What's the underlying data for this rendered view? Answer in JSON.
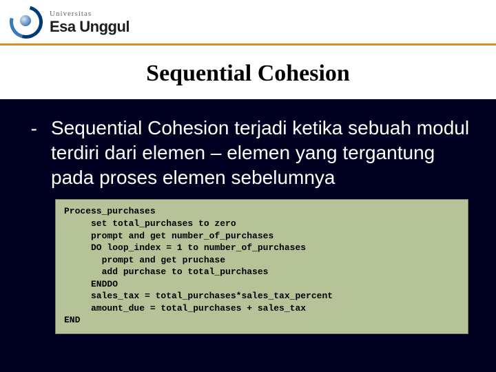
{
  "header": {
    "brand_top": "Universitas",
    "brand_main": "Esa Unggul"
  },
  "slide": {
    "title": "Sequential Cohesion",
    "bullet_dash": "-",
    "bullet": "Sequential Cohesion terjadi ketika sebuah modul terdiri dari elemen – elemen yang tergantung pada proses elemen sebelumnya",
    "code": "Process_purchases\n     set total_purchases to zero\n     prompt and get number_of_purchases\n     DO loop_index = 1 to number_of_purchases\n       prompt and get pruchase\n       add purchase to total_purchases\n     ENDDO\n     sales_tax = total_purchases*sales_tax_percent\n     amount_due = total_purchases + sales_tax\nEND"
  }
}
